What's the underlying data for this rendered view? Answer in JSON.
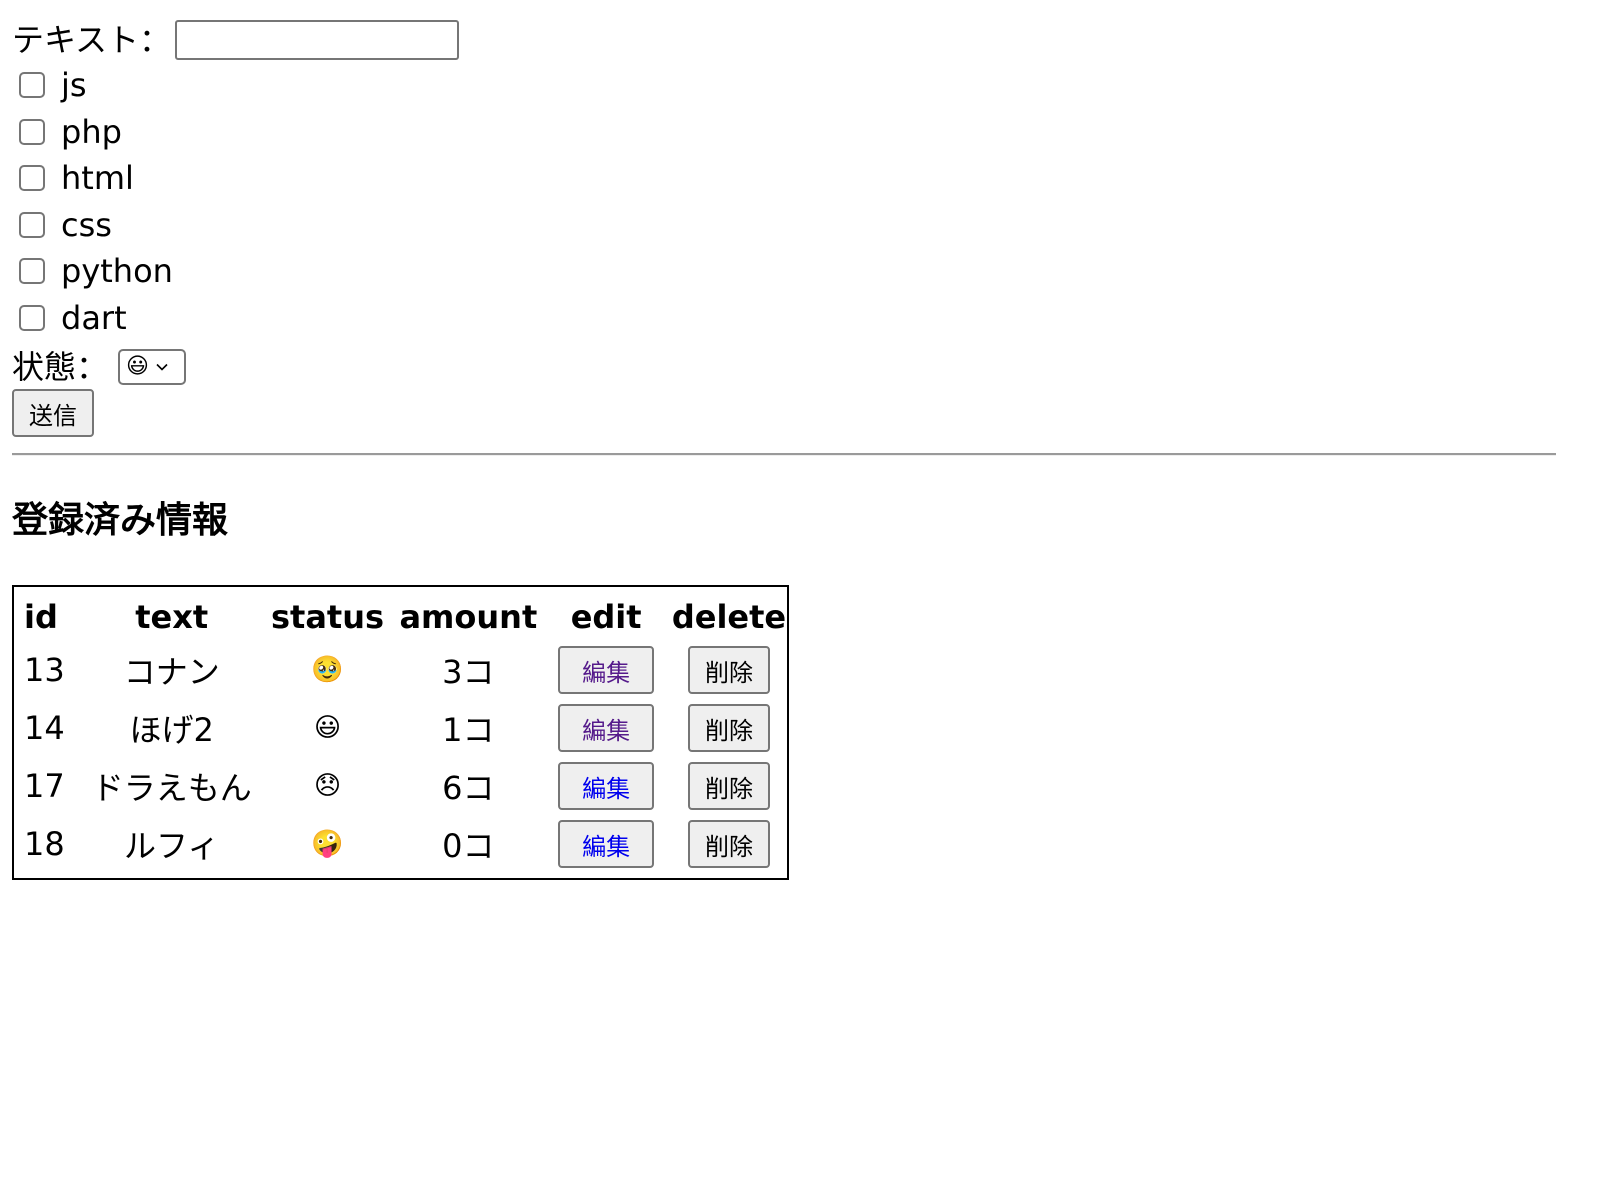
{
  "form": {
    "text_label": "テキスト：",
    "text_value": "",
    "checkboxes": [
      {
        "label": "js",
        "checked": false
      },
      {
        "label": "php",
        "checked": false
      },
      {
        "label": "html",
        "checked": false
      },
      {
        "label": "css",
        "checked": false
      },
      {
        "label": "python",
        "checked": false
      },
      {
        "label": "dart",
        "checked": false
      }
    ],
    "status_label": "状態：",
    "status_selected": "😃",
    "submit_label": "送信"
  },
  "registered": {
    "heading": "登録済み情報",
    "columns": [
      "id",
      "text",
      "status",
      "amount",
      "edit",
      "delete"
    ],
    "rows": [
      {
        "id": "13",
        "text": "コナン",
        "status": "🥹",
        "amount": "3コ",
        "edit": "編集",
        "delete": "削除",
        "edit_link_visited": true
      },
      {
        "id": "14",
        "text": "ほげ2",
        "status": "😃",
        "amount": "1コ",
        "edit": "編集",
        "delete": "削除",
        "edit_link_visited": true
      },
      {
        "id": "17",
        "text": "ドラえもん",
        "status": "😞",
        "amount": "6コ",
        "edit": "編集",
        "delete": "削除",
        "edit_link_visited": false
      },
      {
        "id": "18",
        "text": "ルフィ",
        "status": "🤪",
        "amount": "0コ",
        "edit": "編集",
        "delete": "削除",
        "edit_link_visited": false
      }
    ]
  },
  "colors": {
    "visited_link": "#551a8b",
    "unvisited_link": "#0000ee",
    "button_bg": "#efefef",
    "border": "#767676"
  }
}
